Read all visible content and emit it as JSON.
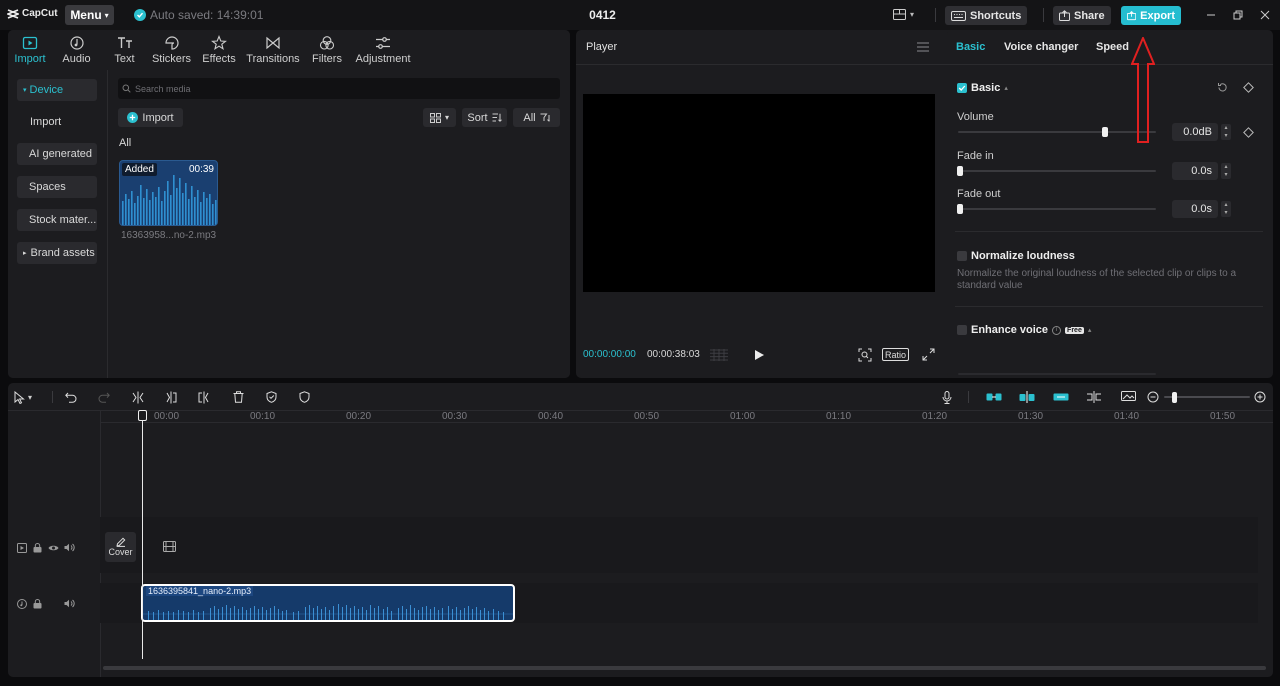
{
  "titlebar": {
    "logo_text": "CapCut",
    "menu_label": "Menu",
    "autosave_text": "Auto saved: 14:39:01",
    "project_title": "0412",
    "shortcuts_label": "Shortcuts",
    "share_label": "Share",
    "export_label": "Export"
  },
  "tool_tabs": [
    {
      "label": "Import",
      "icon": "import-icon",
      "active": true
    },
    {
      "label": "Audio",
      "icon": "audio-icon"
    },
    {
      "label": "Text",
      "icon": "text-icon"
    },
    {
      "label": "Stickers",
      "icon": "stickers-icon"
    },
    {
      "label": "Effects",
      "icon": "effects-icon"
    },
    {
      "label": "Transitions",
      "icon": "transitions-icon"
    },
    {
      "label": "Filters",
      "icon": "filters-icon"
    },
    {
      "label": "Adjustment",
      "icon": "adjustment-icon"
    }
  ],
  "sidebar": {
    "items": [
      {
        "label": "Device",
        "prefix": "▾",
        "active": true
      },
      {
        "label": "Import"
      },
      {
        "label": "AI generated"
      },
      {
        "label": "Spaces"
      },
      {
        "label": "Stock mater..."
      },
      {
        "label": "Brand assets",
        "prefix": "▸"
      }
    ]
  },
  "media": {
    "search_placeholder": "Search media",
    "import_label": "Import",
    "sort_label": "Sort",
    "filter_label": "All",
    "section_label": "All",
    "item": {
      "badge": "Added",
      "duration": "00:39",
      "filename": "16363958...no-2.mp3"
    }
  },
  "player": {
    "title": "Player",
    "current_time": "00:00:00:00",
    "total_time": "00:00:38:03",
    "ratio_label": "Ratio"
  },
  "properties": {
    "tabs": [
      "Basic",
      "Voice changer",
      "Speed"
    ],
    "basic_label": "Basic",
    "volume_label": "Volume",
    "volume_value": "0.0dB",
    "fade_in_label": "Fade in",
    "fade_in_value": "0.0s",
    "fade_out_label": "Fade out",
    "fade_out_value": "0.0s",
    "normalize_label": "Normalize loudness",
    "normalize_desc": "Normalize the original loudness of the selected clip or clips to a standard value",
    "enhance_label": "Enhance voice",
    "enhance_badge": "Free"
  },
  "timeline": {
    "ticks": [
      "00:00",
      "00:10",
      "00:20",
      "00:30",
      "00:40",
      "00:50",
      "01:00",
      "01:10",
      "01:20",
      "01:30",
      "01:40",
      "01:50"
    ],
    "cover_label": "Cover",
    "clip_label": "1636395841_nano-2.mp3"
  },
  "colors": {
    "accent": "#2bc0cf",
    "clip": "#153a6a",
    "annotation": "#e02020"
  }
}
